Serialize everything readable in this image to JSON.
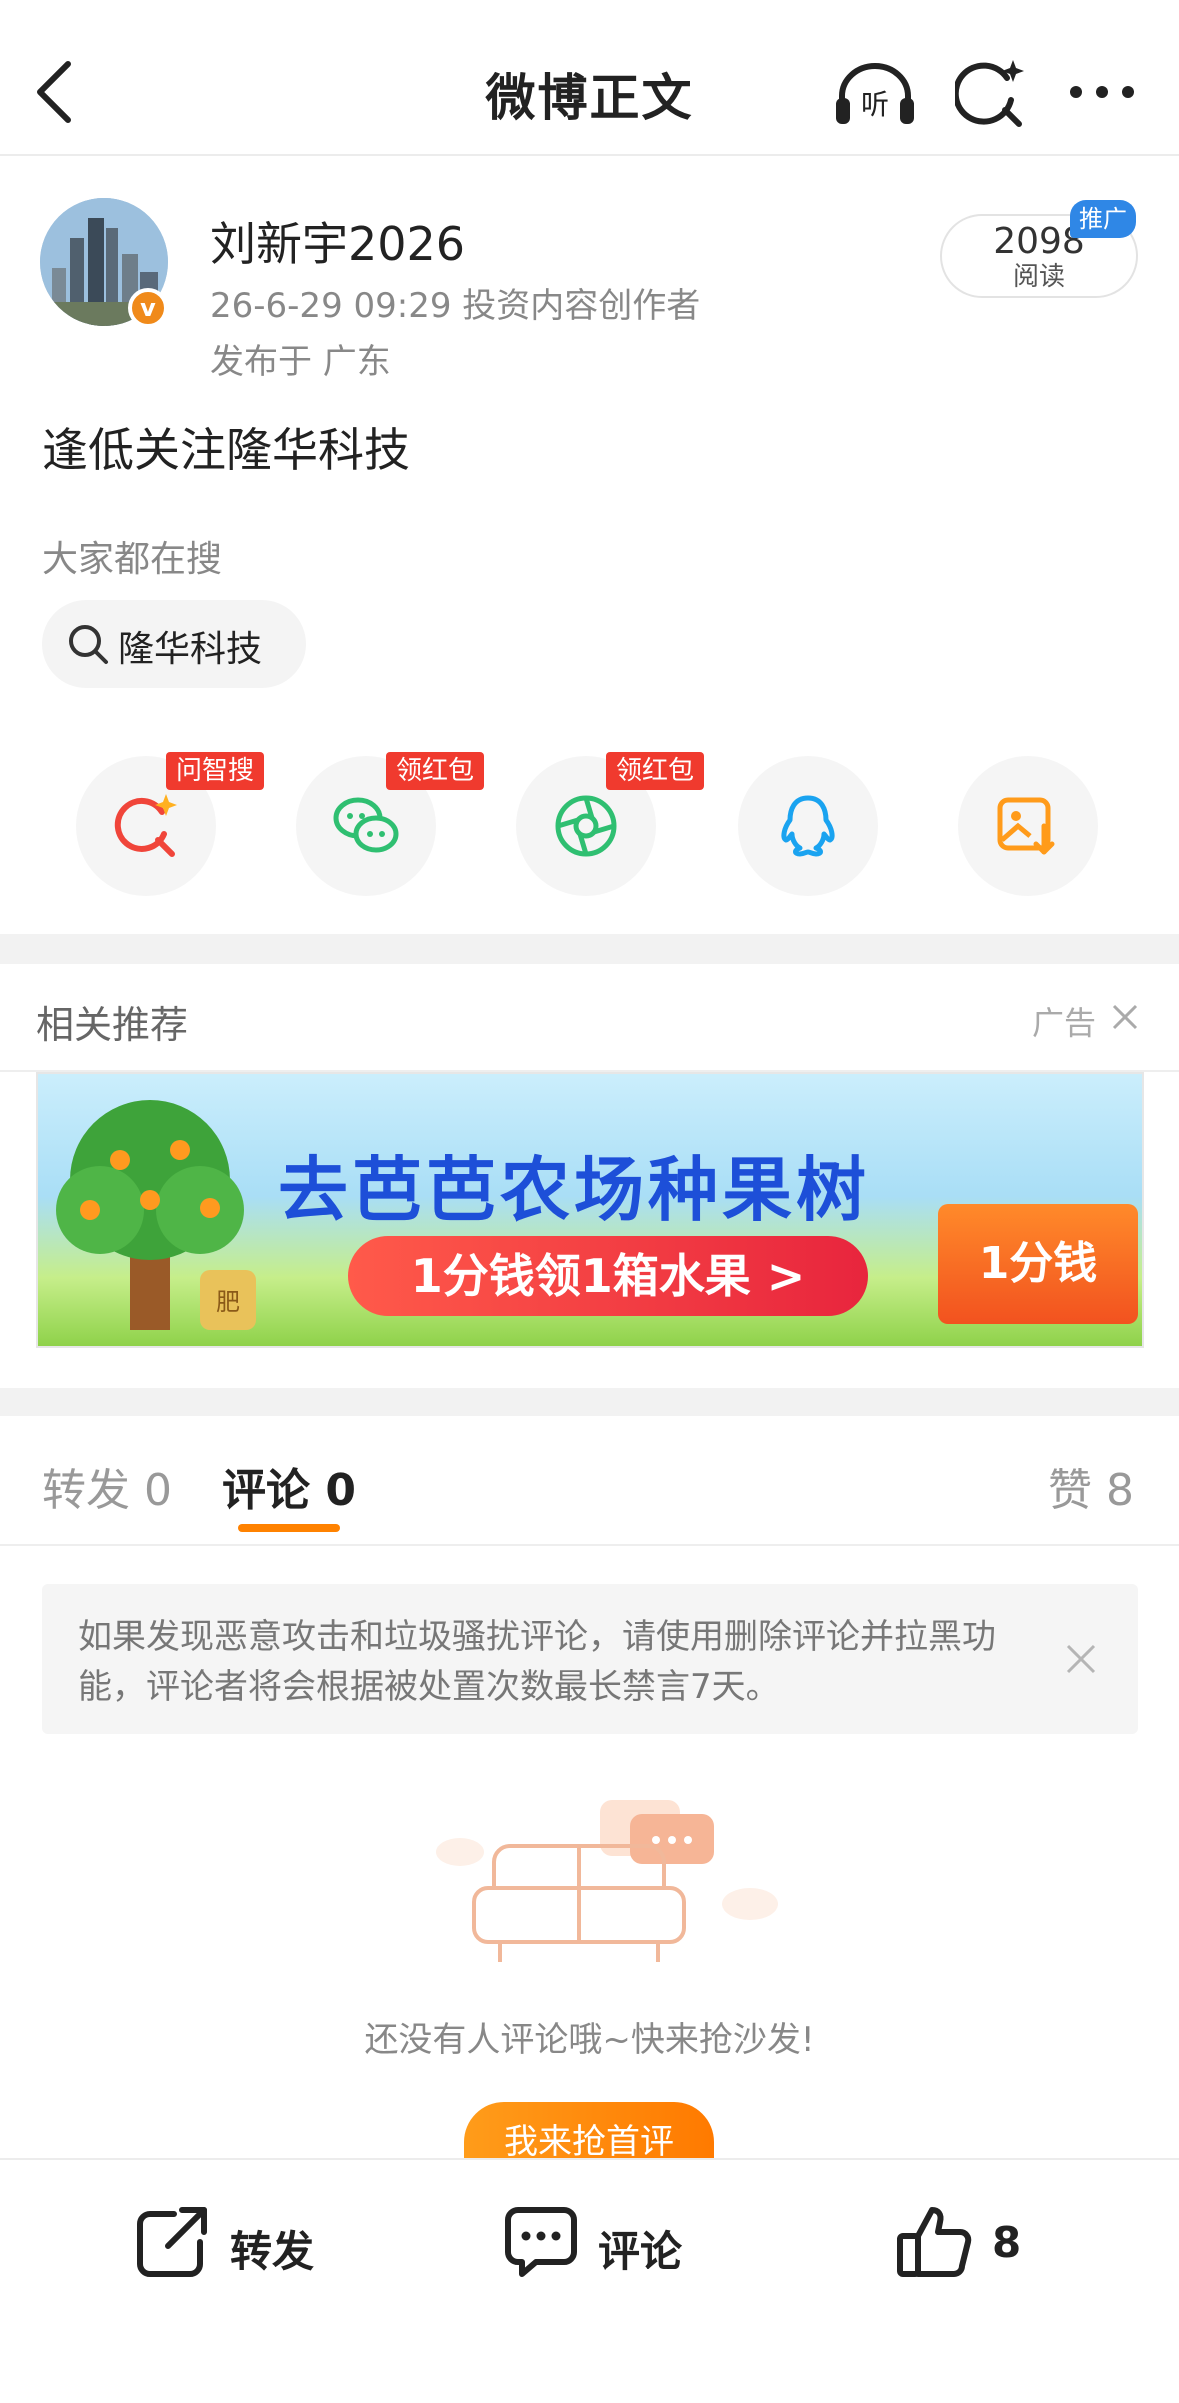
{
  "header": {
    "title": "微博正文",
    "listen_label": "听"
  },
  "author": {
    "name": "刘新宇2026",
    "meta": "26-6-29 09:29  投资内容创作者",
    "location": "发布于 广东",
    "verify_badge": "v",
    "read_count": "2098",
    "read_label": "阅读",
    "promo_tag": "推广"
  },
  "post": {
    "text": "逢低关注隆华科技"
  },
  "hot_search": {
    "label": "大家都在搜",
    "chip": "隆华科技"
  },
  "share": {
    "items": [
      {
        "icon": "ai-search-icon",
        "tag": "问智搜",
        "color": "#f0453a"
      },
      {
        "icon": "wechat-icon",
        "tag": "领红包",
        "color": "#2fbf71"
      },
      {
        "icon": "moments-icon",
        "tag": "领红包",
        "color": "#2fbf71"
      },
      {
        "icon": "qq-icon",
        "tag": "",
        "color": "#1aa3f0"
      },
      {
        "icon": "save-image-icon",
        "tag": "",
        "color": "#ff9b1a"
      }
    ]
  },
  "recommend": {
    "title": "相关推荐",
    "ad_label": "广告",
    "banner_title": "去芭芭农场种果树",
    "banner_cta": "1分钱领1箱水果 >",
    "banner_box": "1分钱",
    "banner_bag": "肥"
  },
  "tabs": [
    {
      "label": "转发 0"
    },
    {
      "label": "评论 0"
    },
    {
      "label": "赞 8"
    }
  ],
  "notice": {
    "text": "如果发现恶意攻击和垃圾骚扰评论，请使用删除评论并拉黑功能，评论者将会根据被处置次数最长禁言7天。"
  },
  "empty": {
    "text": "还没有人评论哦~快来抢沙发!",
    "button": "我来抢首评"
  },
  "bottom_bar": {
    "repost": "转发",
    "comment": "评论",
    "like_count": "8"
  },
  "colors": {
    "accent": "#ff8200",
    "promo": "#2f87e6",
    "red_tag": "#f03a2e"
  }
}
